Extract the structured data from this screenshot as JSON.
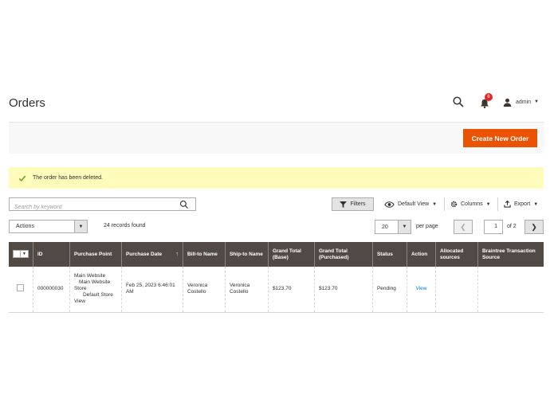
{
  "page": {
    "title": "Orders"
  },
  "header": {
    "notification_count": "6",
    "user_name": "admin",
    "icons": [
      "search-icon",
      "bell-icon",
      "user-icon"
    ]
  },
  "actions": {
    "create_label": "Create New Order"
  },
  "message": {
    "text": "The order has been deleted."
  },
  "toolbar": {
    "search_placeholder": "Search by keyword",
    "filters_label": "Filters",
    "view_label": "Default View",
    "columns_label": "Columns",
    "export_label": "Export"
  },
  "listing": {
    "mass_action_label": "Actions",
    "records_found": "24 records found",
    "per_page_value": "20",
    "per_page_label": "per page",
    "current_page": "1",
    "total_pages_label": "of 2"
  },
  "table": {
    "columns": [
      "ID",
      "Purchase Point",
      "Purchase Date",
      "Bill-to Name",
      "Ship-to Name",
      "Grand Total (Base)",
      "Grand Total (Purchased)",
      "Status",
      "Action",
      "Allocated sources",
      "Braintree Transaction Source"
    ],
    "sorted_column": "Purchase Date",
    "rows": [
      {
        "id": "000000030",
        "purchase_point": [
          "Main Website",
          "Main Website",
          "Store",
          "Default Store",
          "View"
        ],
        "purchase_date": "Feb 25, 2023 6:46:01 AM",
        "bill_to": "Veronica Costello",
        "ship_to": "Veronica Costello",
        "grand_total_base": "$123.70",
        "grand_total_purchased": "$123.70",
        "status": "Pending",
        "action": "View",
        "allocated_sources": "",
        "braintree_source": ""
      }
    ]
  },
  "colors": {
    "accent": "#eb5202",
    "header_bg": "#514943",
    "message_bg": "#fffbbb",
    "link": "#007bdb",
    "badge": "#e22626"
  }
}
